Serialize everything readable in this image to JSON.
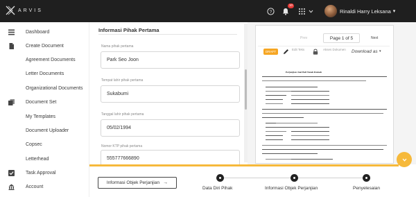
{
  "app": {
    "logo_text": "ARVIS"
  },
  "topbar": {
    "notification_count": "10",
    "user_name": "Rinaldi Harry Leksana"
  },
  "sidebar": {
    "items": [
      {
        "label": "Dashboard",
        "icon": "dashboard-icon"
      },
      {
        "label": "Create Document",
        "icon": "document-icon"
      },
      {
        "label": "Agreement Documents",
        "icon": ""
      },
      {
        "label": "Letter Documents",
        "icon": ""
      },
      {
        "label": "Organizational Documents",
        "icon": ""
      },
      {
        "label": "Document Set",
        "icon": "document-set-icon"
      },
      {
        "label": "My Templates",
        "icon": ""
      },
      {
        "label": "Document Uploader",
        "icon": ""
      },
      {
        "label": "Copsec",
        "icon": ""
      },
      {
        "label": "Letterhead",
        "icon": ""
      },
      {
        "label": "Task Approval",
        "icon": "check-square-icon"
      },
      {
        "label": "Account",
        "icon": "building-icon"
      }
    ]
  },
  "form": {
    "title": "Informasi Pihak Pertama",
    "fields": [
      {
        "label": "Nama pihak pertama",
        "value": "Park Seo Joon"
      },
      {
        "label": "Tempat lahir pihak pertama",
        "value": "Sukabumi"
      },
      {
        "label": "Tanggal lahir pihak pertama",
        "value": "05/02/1994"
      },
      {
        "label": "Nomor KTP pihak pertama",
        "value": "555777666890"
      }
    ]
  },
  "preview": {
    "prev_label": "Prev",
    "page_label": "Page 1 of 5",
    "next_label": "Next",
    "status_badge": "DRAFT",
    "edit_label": "Edit Teks",
    "access_label": "Akses Dokumen",
    "download_label": "Download as",
    "doc_title": "Perjanjian Jual Beli Tanah Rumah"
  },
  "stepper": {
    "action_button": "Informasi Objek Perjanjian",
    "steps": [
      {
        "label": "Data Diri Pihak"
      },
      {
        "label": "Informasi Objek Perjanjian"
      },
      {
        "label": "Penyelesaian"
      }
    ]
  },
  "colors": {
    "accent": "#f6b93b",
    "topbar": "#1f1f1f",
    "draft": "#f6a623"
  }
}
